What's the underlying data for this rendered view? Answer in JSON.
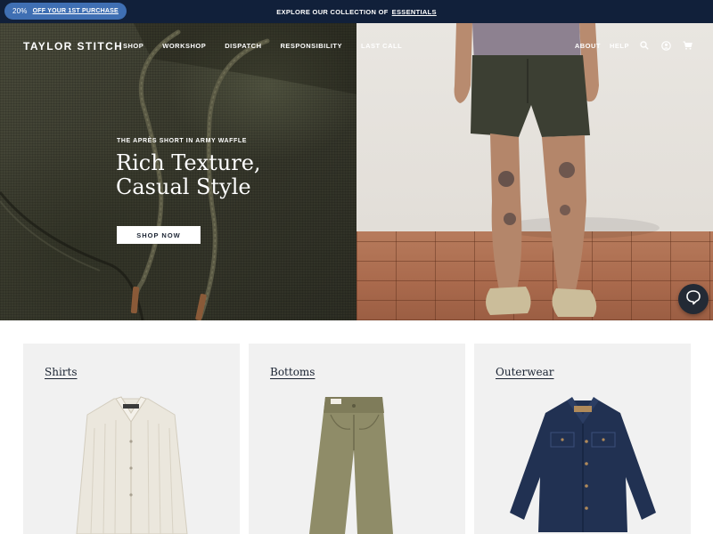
{
  "announcement": {
    "promo_percent": "20%",
    "promo_text": "OFF YOUR 1ST PURCHASE",
    "center_text": "EXPLORE OUR COLLECTION OF",
    "center_link": "ESSENTIALS",
    "bar_color": "#11203a",
    "pill_color": "#3f6fb3"
  },
  "header": {
    "logo": "TAYLOR STITCH",
    "nav": [
      "SHOP",
      "WORKSHOP",
      "DISPATCH",
      "RESPONSIBILITY",
      "LAST CALL"
    ],
    "utility": [
      "ABOUT",
      "HELP"
    ],
    "icons": [
      "search-icon",
      "account-icon",
      "cart-icon"
    ]
  },
  "hero": {
    "eyebrow": "THE APRÈS SHORT IN ARMY WAFFLE",
    "headline_line1": "Rich Texture,",
    "headline_line2": "Casual Style",
    "cta": "SHOP NOW"
  },
  "chat": {
    "icon": "chat-bubble-icon"
  },
  "categories": [
    {
      "label": "Shirts"
    },
    {
      "label": "Bottoms"
    },
    {
      "label": "Outerwear"
    }
  ]
}
